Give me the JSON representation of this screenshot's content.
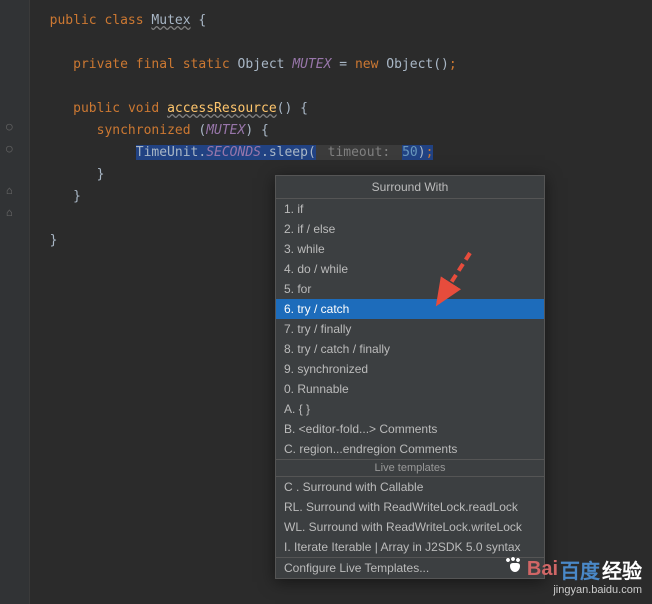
{
  "code": {
    "line1_kw1": "public",
    "line1_kw2": "class",
    "line1_class": "Mutex",
    "line1_brace": " {",
    "line3_kw1": "private",
    "line3_kw2": "final",
    "line3_kw3": "static",
    "line3_type": " Object ",
    "line3_field": "MUTEX",
    "line3_eq": " = ",
    "line3_new": "new",
    "line3_obj": " Object()",
    "line3_semi": ";",
    "line5_kw1": "public",
    "line5_kw2": "void",
    "line5_method": "accessResource",
    "line5_end": "() {",
    "line6_kw": "synchronized",
    "line6_paren": " (",
    "line6_mutex": "MUTEX",
    "line6_end": ") {",
    "line7_class": "TimeUnit.",
    "line7_const": "SECONDS",
    "line7_dot": ".",
    "line7_sleep": "sleep",
    "line7_open": "(",
    "line7_hint": " timeout: ",
    "line7_num": "50",
    "line7_close": ")",
    "line7_semi": ";",
    "line8_brace": "}",
    "line9_brace": "}",
    "line10_brace": "}"
  },
  "popup": {
    "title": "Surround With",
    "items": [
      "1. if",
      "2. if / else",
      "3. while",
      "4. do / while",
      "5. for",
      "6. try / catch",
      "7. try / finally",
      "8. try / catch / finally",
      "9. synchronized",
      "0. Runnable",
      "A. { }",
      "B.  <editor-fold...> Comments",
      "C.  region...endregion Comments"
    ],
    "selected_index": 5,
    "sep": "Live templates",
    "live_items": [
      "C . Surround with Callable",
      "RL. Surround with ReadWriteLock.readLock",
      "WL. Surround with ReadWriteLock.writeLock",
      "I.  Iterate Iterable | Array in J2SDK 5.0 syntax"
    ],
    "configure": "Configure Live Templates..."
  },
  "watermark": {
    "brand": "Bai",
    "brand2": "百度",
    "brand3": "经验",
    "url": "jingyan.baidu.com"
  }
}
